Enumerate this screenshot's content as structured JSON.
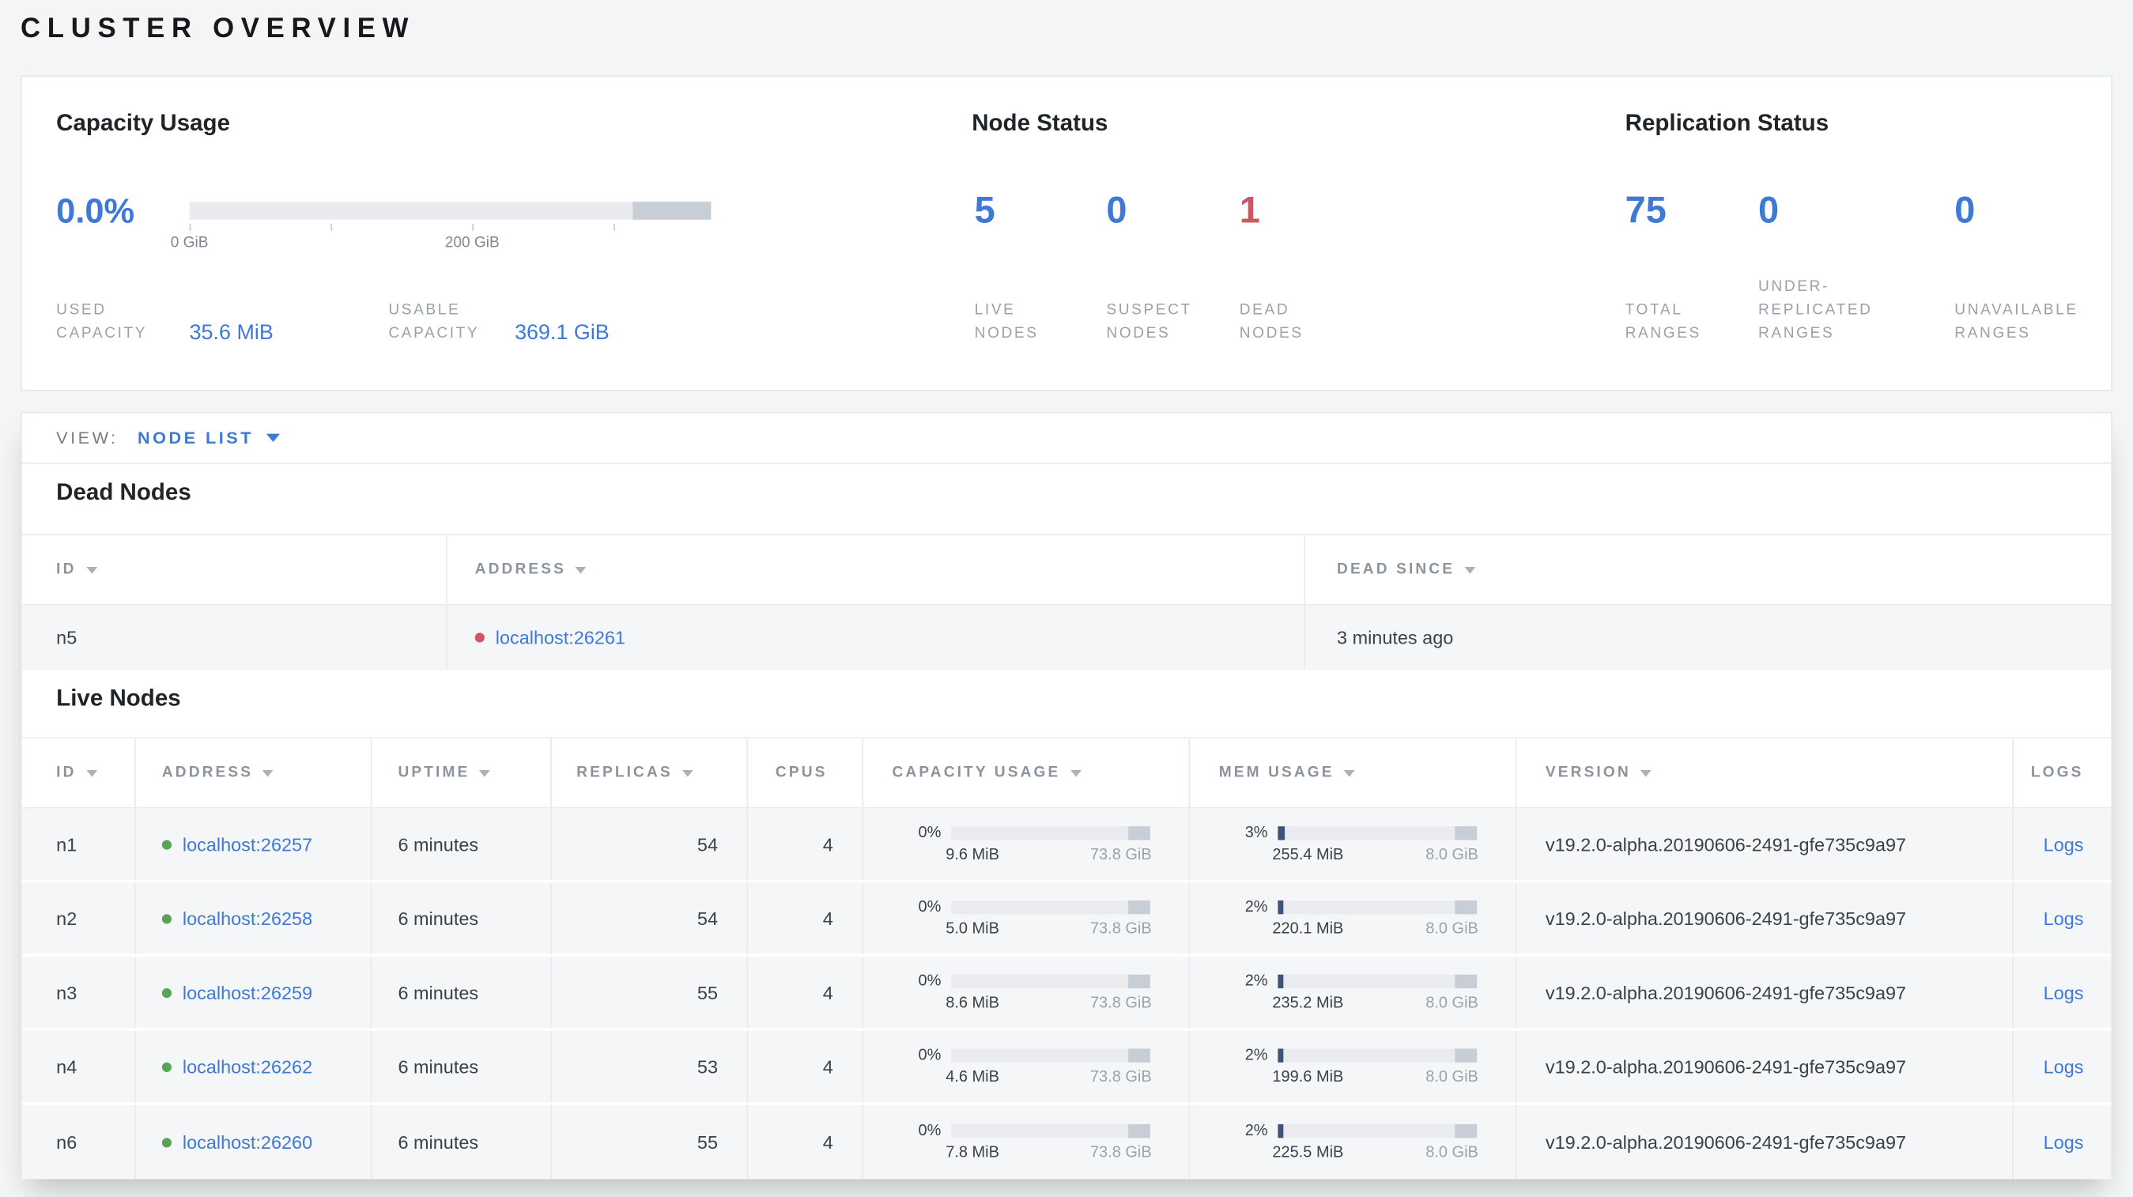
{
  "title": "CLUSTER OVERVIEW",
  "summary": {
    "capacity": {
      "heading": "Capacity Usage",
      "percent": "0.0%",
      "tick_labels": [
        "0 GiB",
        "200 GiB"
      ],
      "used": {
        "label": "USED CAPACITY",
        "value": "35.6 MiB"
      },
      "usable": {
        "label": "USABLE CAPACITY",
        "value": "369.1 GiB"
      }
    },
    "node_status": {
      "heading": "Node Status",
      "stats": [
        {
          "value": "5",
          "label": "LIVE NODES"
        },
        {
          "value": "0",
          "label": "SUSPECT NODES"
        },
        {
          "value": "1",
          "label": "DEAD NODES"
        }
      ]
    },
    "replication": {
      "heading": "Replication Status",
      "stats": [
        {
          "value": "75",
          "label": "TOTAL RANGES"
        },
        {
          "value": "0",
          "label": "UNDER-REPLICATED RANGES"
        },
        {
          "value": "0",
          "label": "UNAVAILABLE RANGES"
        }
      ]
    }
  },
  "view_bar": {
    "label": "VIEW:",
    "selected": "NODE LIST"
  },
  "dead_nodes": {
    "heading": "Dead Nodes",
    "columns": [
      {
        "label": "ID"
      },
      {
        "label": "ADDRESS"
      },
      {
        "label": "DEAD SINCE"
      }
    ],
    "rows": [
      {
        "id": "n5",
        "address": "localhost:26261",
        "dead_since": "3 minutes ago"
      }
    ]
  },
  "live_nodes": {
    "heading": "Live Nodes",
    "logs_label": "Logs",
    "columns": [
      {
        "label": "ID"
      },
      {
        "label": "ADDRESS"
      },
      {
        "label": "UPTIME"
      },
      {
        "label": "REPLICAS"
      },
      {
        "label": "CPUS"
      },
      {
        "label": "CAPACITY USAGE"
      },
      {
        "label": "MEM USAGE"
      },
      {
        "label": "VERSION"
      },
      {
        "label": "LOGS"
      }
    ],
    "rows": [
      {
        "id": "n1",
        "address": "localhost:26257",
        "uptime": "6 minutes",
        "replicas": "54",
        "cpus": "4",
        "cap_pct": "0%",
        "cap_used": "9.6 MiB",
        "cap_total": "73.8 GiB",
        "mem_pct": "3%",
        "mem_used": "255.4 MiB",
        "mem_total": "8.0 GiB",
        "version": "v19.2.0-alpha.20190606-2491-gfe735c9a97"
      },
      {
        "id": "n2",
        "address": "localhost:26258",
        "uptime": "6 minutes",
        "replicas": "54",
        "cpus": "4",
        "cap_pct": "0%",
        "cap_used": "5.0 MiB",
        "cap_total": "73.8 GiB",
        "mem_pct": "2%",
        "mem_used": "220.1 MiB",
        "mem_total": "8.0 GiB",
        "version": "v19.2.0-alpha.20190606-2491-gfe735c9a97"
      },
      {
        "id": "n3",
        "address": "localhost:26259",
        "uptime": "6 minutes",
        "replicas": "55",
        "cpus": "4",
        "cap_pct": "0%",
        "cap_used": "8.6 MiB",
        "cap_total": "73.8 GiB",
        "mem_pct": "2%",
        "mem_used": "235.2 MiB",
        "mem_total": "8.0 GiB",
        "version": "v19.2.0-alpha.20190606-2491-gfe735c9a97"
      },
      {
        "id": "n4",
        "address": "localhost:26262",
        "uptime": "6 minutes",
        "replicas": "53",
        "cpus": "4",
        "cap_pct": "0%",
        "cap_used": "4.6 MiB",
        "cap_total": "73.8 GiB",
        "mem_pct": "2%",
        "mem_used": "199.6 MiB",
        "mem_total": "8.0 GiB",
        "version": "v19.2.0-alpha.20190606-2491-gfe735c9a97"
      },
      {
        "id": "n6",
        "address": "localhost:26260",
        "uptime": "6 minutes",
        "replicas": "55",
        "cpus": "4",
        "cap_pct": "0%",
        "cap_used": "7.8 MiB",
        "cap_total": "73.8 GiB",
        "mem_pct": "2%",
        "mem_used": "225.5 MiB",
        "mem_total": "8.0 GiB",
        "version": "v19.2.0-alpha.20190606-2491-gfe735c9a97"
      }
    ]
  }
}
